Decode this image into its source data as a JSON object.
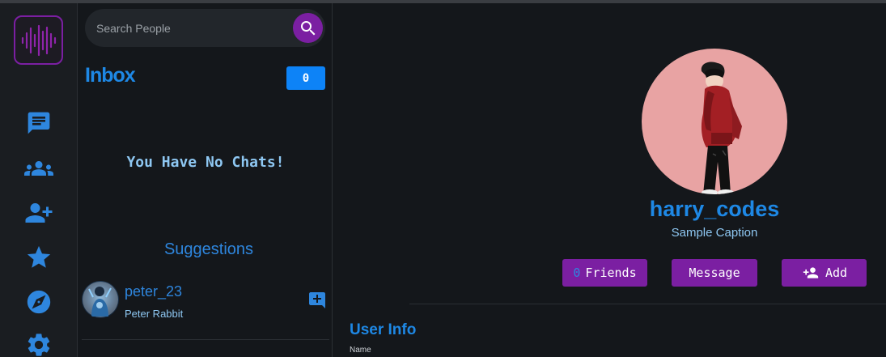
{
  "search": {
    "placeholder": "Search People"
  },
  "inbox": {
    "title": "Inbox",
    "count": "0",
    "empty_message": "You Have No Chats!"
  },
  "suggestions": {
    "title": "Suggestions",
    "items": [
      {
        "username": "peter_23",
        "full_name": "Peter Rabbit"
      }
    ]
  },
  "nav": [
    "chat-icon",
    "groups-icon",
    "add-friend-icon",
    "star-icon",
    "compass-icon",
    "settings-icon"
  ],
  "profile": {
    "username": "harry_codes",
    "caption": "Sample Caption",
    "friends_count": "0",
    "friends_label": "Friends",
    "message_label": "Message",
    "add_label": "Add",
    "user_info_title": "User Info",
    "name_label": "Name"
  },
  "colors": {
    "accent_purple": "#7b1fa2",
    "accent_blue": "#1e88e5",
    "background": "#14171b"
  }
}
